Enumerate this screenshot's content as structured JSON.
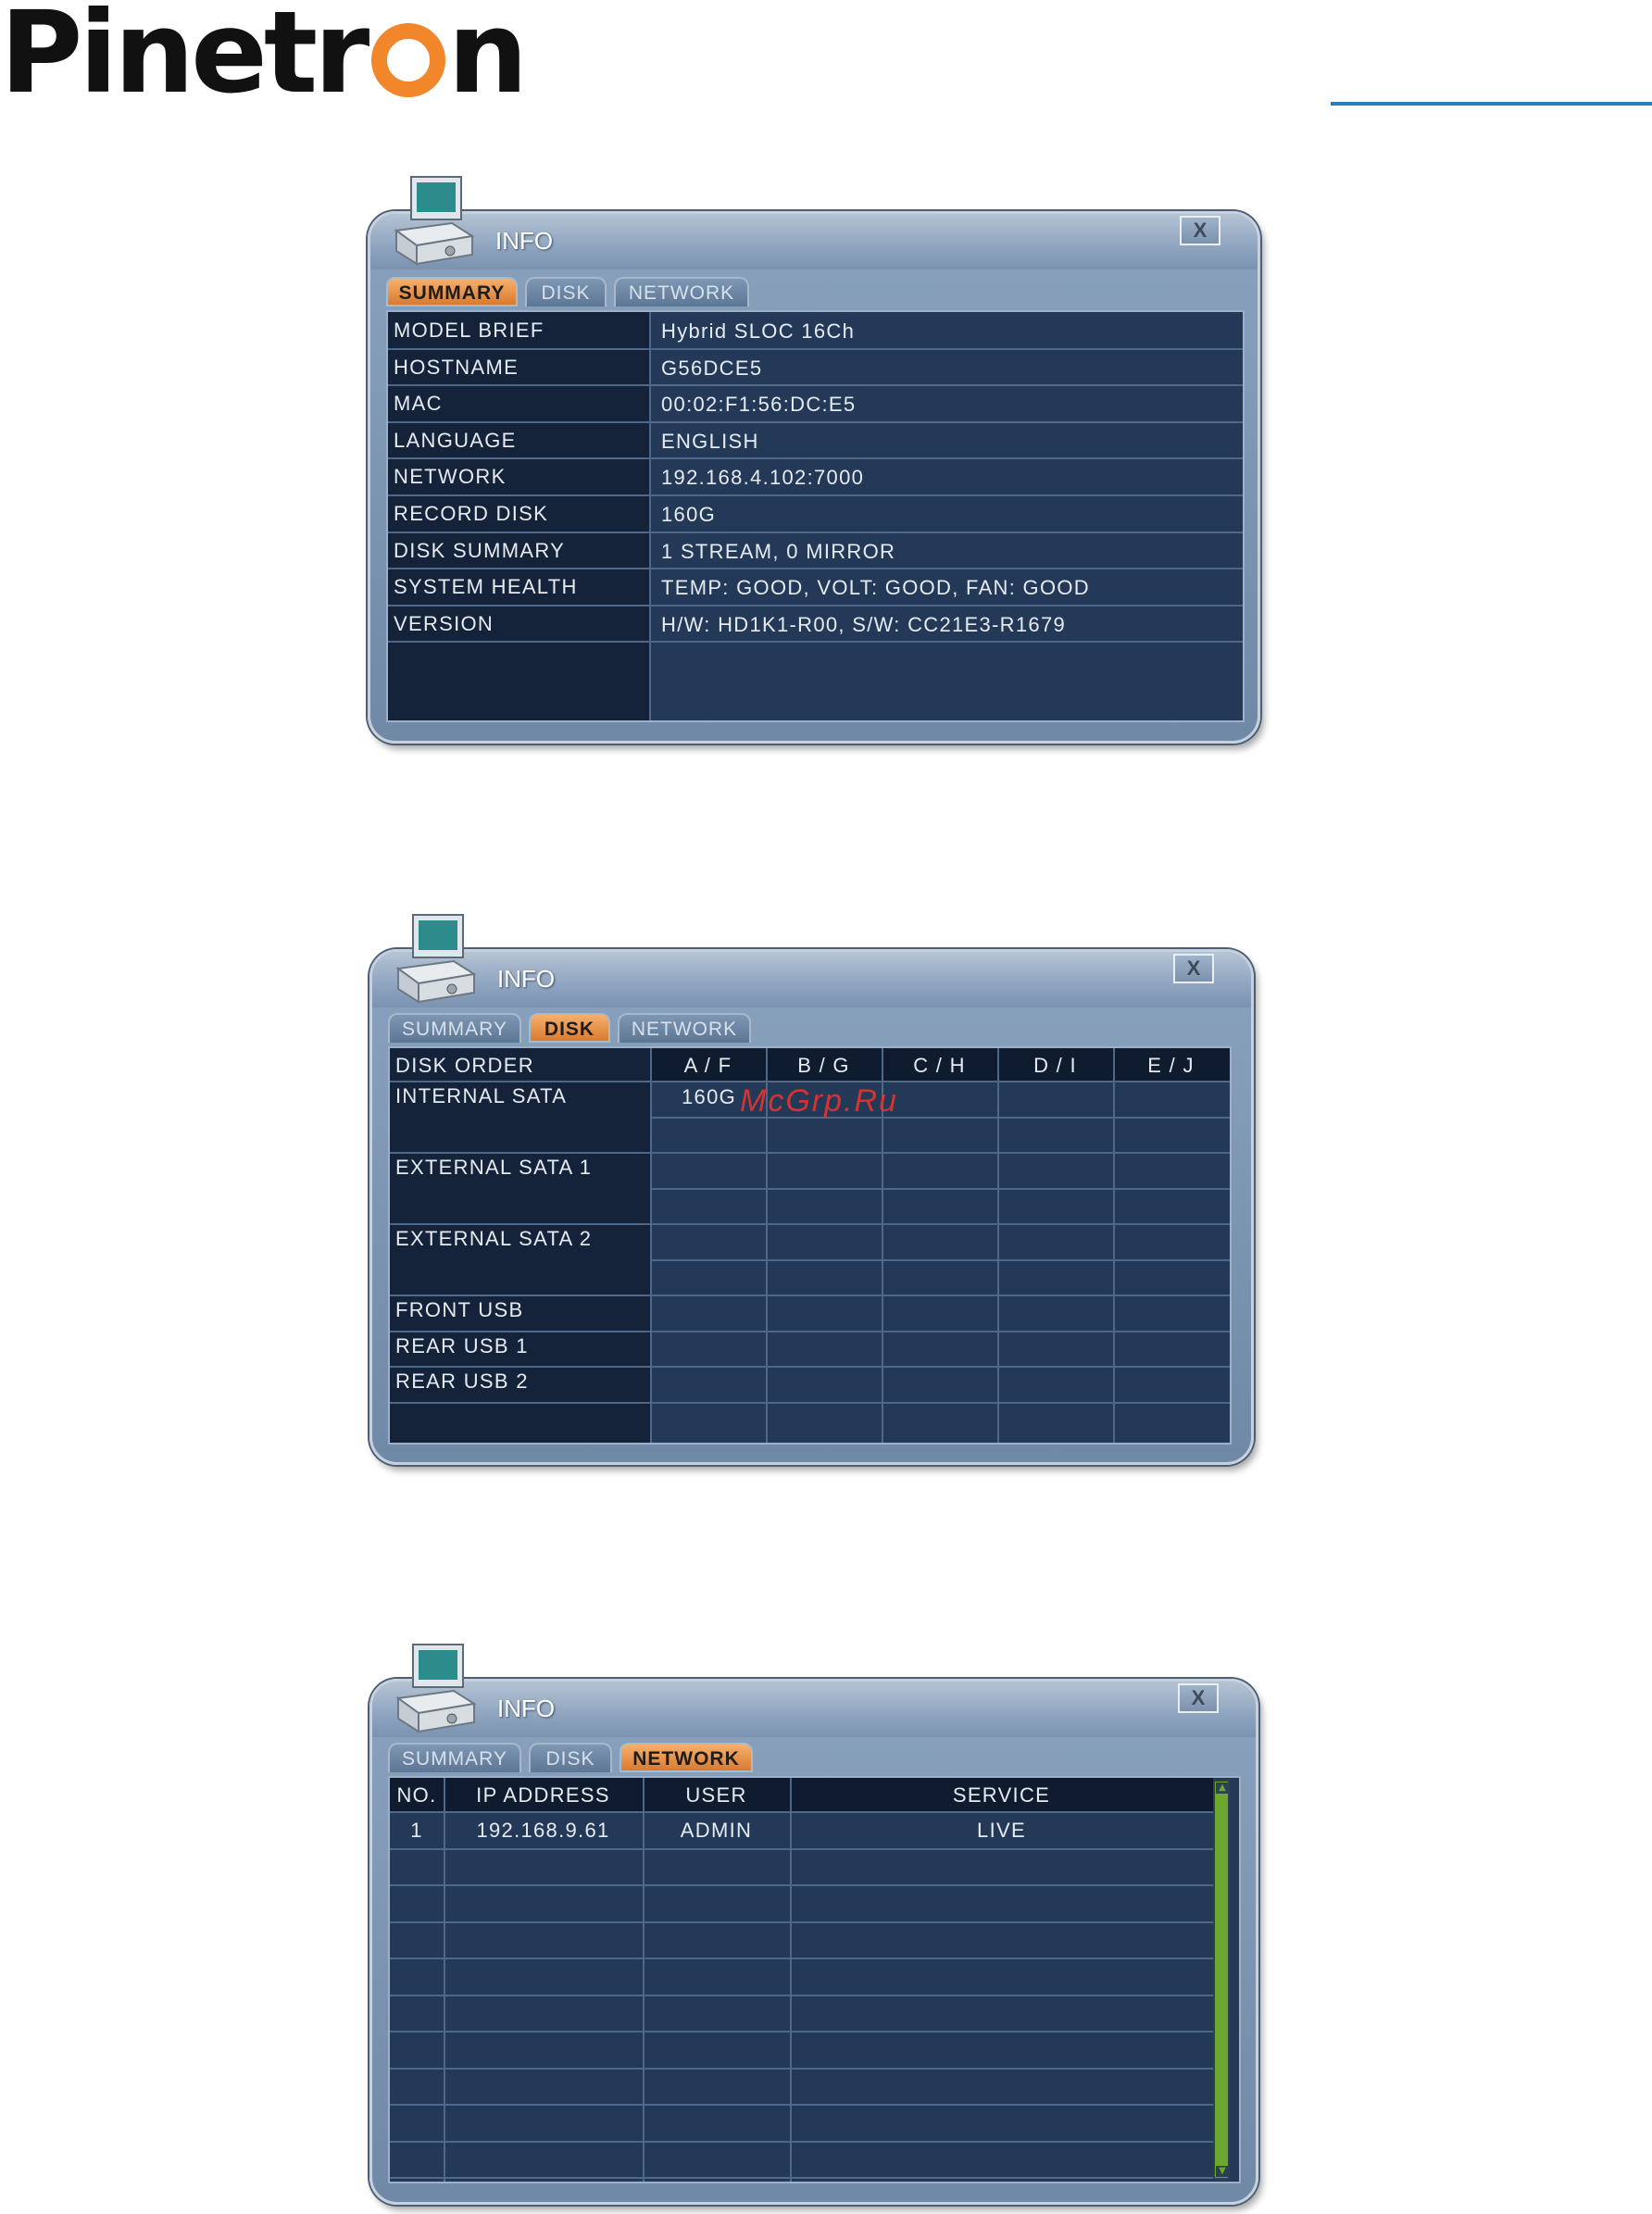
{
  "logo": {
    "left": "Pinetr",
    "right": "n"
  },
  "summary_window": {
    "title": "INFO",
    "close_label": "X",
    "tabs": [
      "SUMMARY",
      "DISK",
      "NETWORK"
    ],
    "active_tab": "SUMMARY",
    "rows": [
      {
        "label": "MODEL BRIEF",
        "value": "Hybrid SLOC 16Ch"
      },
      {
        "label": "HOSTNAME",
        "value": "G56DCE5"
      },
      {
        "label": "MAC",
        "value": "00:02:F1:56:DC:E5"
      },
      {
        "label": "LANGUAGE",
        "value": "ENGLISH"
      },
      {
        "label": "NETWORK",
        "value": "192.168.4.102:7000"
      },
      {
        "label": "RECORD DISK",
        "value": "160G"
      },
      {
        "label": "DISK SUMMARY",
        "value": "1 STREAM, 0 MIRROR"
      },
      {
        "label": "SYSTEM HEALTH",
        "value": "TEMP: GOOD, VOLT: GOOD, FAN: GOOD"
      },
      {
        "label": "VERSION",
        "value": "H/W: HD1K1-R00, S/W: CC21E3-R1679"
      }
    ]
  },
  "disk_window": {
    "title": "INFO",
    "close_label": "X",
    "tabs": [
      "SUMMARY",
      "DISK",
      "NETWORK"
    ],
    "active_tab": "DISK",
    "header_label": "DISK ORDER",
    "columns": [
      "A / F",
      "B / G",
      "C / H",
      "D / I",
      "E / J"
    ],
    "rows": [
      {
        "label": "INTERNAL SATA",
        "first_value": "160G"
      },
      {
        "label": "EXTERNAL SATA 1",
        "first_value": ""
      },
      {
        "label": "EXTERNAL SATA 2",
        "first_value": ""
      },
      {
        "label": "FRONT USB",
        "first_value": ""
      },
      {
        "label": "REAR USB 1",
        "first_value": ""
      },
      {
        "label": "REAR USB 2",
        "first_value": ""
      }
    ],
    "watermark": "McGrp.Ru"
  },
  "network_window": {
    "title": "INFO",
    "close_label": "X",
    "tabs": [
      "SUMMARY",
      "DISK",
      "NETWORK"
    ],
    "active_tab": "NETWORK",
    "columns": [
      "NO.",
      "IP ADDRESS",
      "USER",
      "SERVICE"
    ],
    "rows": [
      {
        "no": "1",
        "ip": "192.168.9.61",
        "user": "ADMIN",
        "service": "LIVE"
      }
    ]
  },
  "colors": {
    "accent_tab": "#d97a30",
    "panel": "#233957",
    "logo_orange": "#f2862a",
    "rule_blue": "#2b7bbf",
    "scrollbar": "#6ca830",
    "watermark": "#e8332b"
  }
}
